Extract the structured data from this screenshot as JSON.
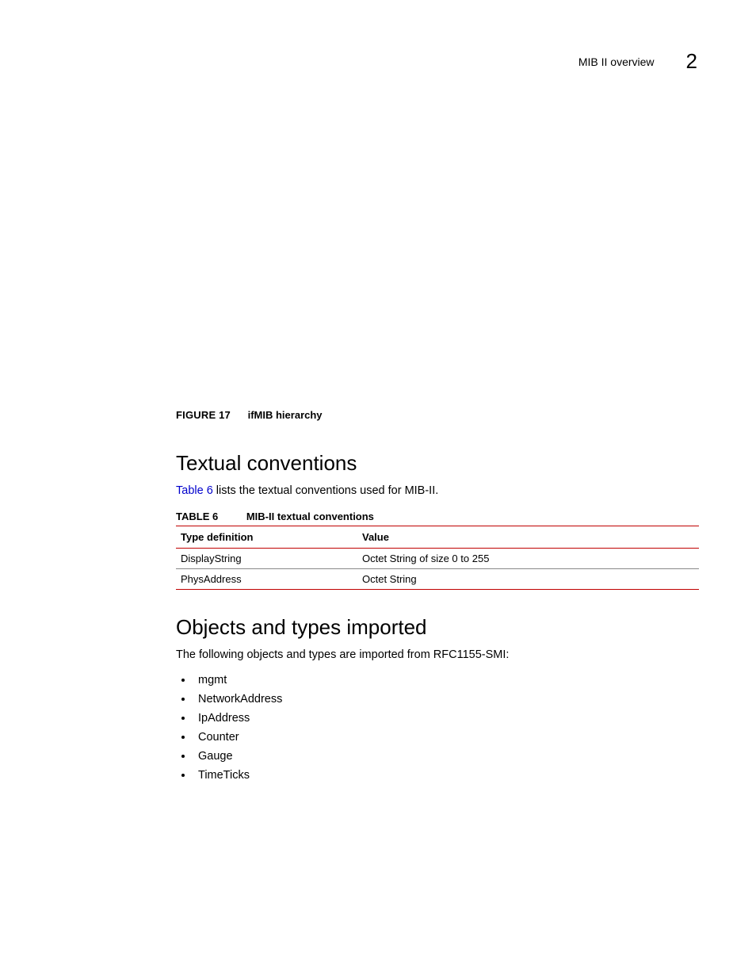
{
  "header": {
    "section_name": "MIB II overview",
    "chapter_number": "2"
  },
  "figure": {
    "label": "FIGURE 17",
    "title": "ifMIB hierarchy"
  },
  "section1": {
    "heading": "Textual conventions",
    "intro_link_text": "Table 6",
    "intro_rest": " lists the textual conventions used for MIB-II.",
    "table": {
      "label": "TABLE 6",
      "title": "MIB-II textual conventions",
      "headers": [
        "Type definition",
        "Value"
      ],
      "rows": [
        [
          "DisplayString",
          "Octet String of size 0 to 255"
        ],
        [
          "PhysAddress",
          "Octet String"
        ]
      ]
    }
  },
  "section2": {
    "heading": "Objects and types imported",
    "intro": "The following objects and types are imported from RFC1155-SMI:",
    "items": [
      "mgmt",
      "NetworkAddress",
      "IpAddress",
      "Counter",
      "Gauge",
      "TimeTicks"
    ]
  }
}
